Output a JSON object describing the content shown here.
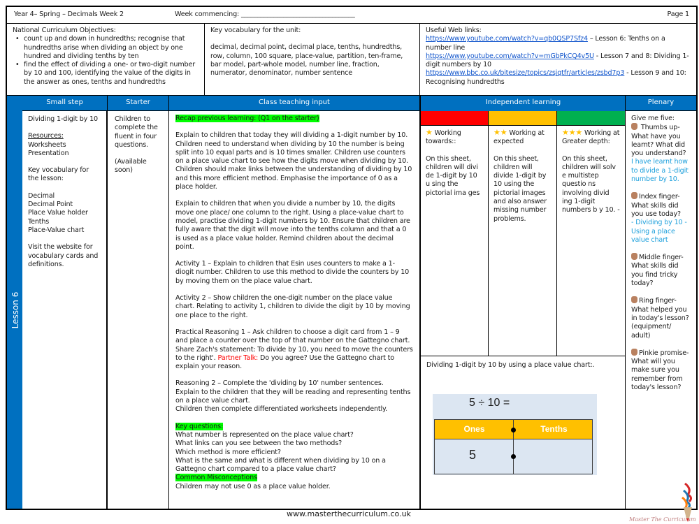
{
  "header": {
    "title": "Year 4– Spring – Decimals  Week 2",
    "week_commencing": "Week commencing: ___________________________________",
    "page": "Page 1"
  },
  "objectives": {
    "heading": "National Curriculum Objectives:",
    "items": [
      "count up and down in hundredths; recognise that hundredths arise when dividing an object by one hundred and dividing tenths by ten",
      "find the effect of dividing a one- or two-digit number by 10 and 100, identifying the value of the digits in the answer as ones, tenths and hundredths"
    ]
  },
  "vocabulary": {
    "heading": "Key vocabulary for the unit:",
    "text": "decimal, decimal point, decimal place, tenths, hundredths, row, column, 100 square, place-value, partition, ten-frame, bar model, part-whole model, number line, fraction, numerator, denominator, number sentence"
  },
  "web_links": {
    "heading": "Useful Web links:",
    "links": [
      {
        "url": "https://www.youtube.com/watch?v=qb0QSP7Sfz4",
        "desc": " – Lesson 6: Tenths on a number line"
      },
      {
        "url": "https://www.youtube.com/watch?v=mGbPkCQ4v5U",
        "desc": " - Lesson 7 and 8: Dividing 1-digit  numbers by 10"
      },
      {
        "url": "https://www.bbc.co.uk/bitesize/topics/zsjqtfr/articles/zsbd7p3",
        "desc": " -  Lesson 9 and 10: Recognising hundredths"
      }
    ]
  },
  "columns": {
    "small_step": "Small step",
    "starter": "Starter",
    "class_teaching": "Class teaching input",
    "independent": "Independent learning",
    "plenary": "Plenary"
  },
  "lesson_label": "Lesson 6",
  "small_step": {
    "title": "Dividing 1-digit by 10",
    "resources_heading": "Resources:",
    "resources": [
      "Worksheets",
      "Presentation"
    ],
    "vocab_heading": "Key vocabulary for the lesson:",
    "vocab": [
      "Decimal",
      "Decimal Point",
      "Place Value holder",
      "Tenths",
      "Place-Value chart"
    ],
    "visit": "Visit the website for vocabulary cards and definitions."
  },
  "starter": {
    "text": "Children to complete the fluent in four questions.",
    "note": "(Available soon)"
  },
  "teaching": {
    "recap": "Recap previous learning: (Q1 on the starter)",
    "para1": "Explain to children that today they will dividing a 1-digit number by 10. Children need to understand when dividing by 10 the number is being split into 10 equal parts and is 10 times smaller. Children use counters on a place value chart to see how the digits move when dividing by 10. Children should make links between the understanding of dividing by 10 and this more efficient method. Emphasise the importance of 0 as a place holder.",
    "para2": "Explain to children that when you divide a number by 10, the digits move one place/ one column to the right. Using a place-value chart to model, practise dividing 1-digit numbers by 10. Ensure that children are fully aware that the digit will move into the tenths column and that a 0 is used as a place value holder. Remind children about the decimal point.",
    "activity1": "Activity 1 – Explain to children that Esin uses counters to make a 1-diogit number. Children to use this method to divide the counters by 10 by moving them on the place value chart.",
    "activity2": "Activity 2 – Show children the one-digit number on the place value chart. Relating to activity 1, children to divide the digit by 10 by moving one place to the right.",
    "reasoning1_a": "Practical Reasoning 1 – Ask children to choose a digit card from 1 – 9 and place a counter over the top of that number on the Gattegno chart. Share Zach's statement: To divide by 10, you need to move the counters to the right'. ",
    "partner_talk": "Partner Talk:",
    "reasoning1_b": " Do you agree? Use the Gattegno chart to explain your reason.",
    "reasoning2": "Reasoning 2 – Complete the 'dividing by 10'  number sentences.",
    "reasoning2_b": "Explain to the children that they will be reading and representing tenths on a place value chart.",
    "reasoning2_c": "Children then complete differentiated worksheets independently.",
    "key_questions_heading": "Key questions:",
    "key_questions": [
      "What number is represented on the place value chart?",
      "What links can you see between the two methods?",
      "Which method is more efficient?",
      "What is the same and what is different when dividing by 10 on a Gattegno chart compared to a place value chart?"
    ],
    "misconceptions_heading": "Common Misconceptions",
    "misconceptions": "Children may not use 0 as a place value holder."
  },
  "independent": {
    "colors": [
      "#ff0000",
      "#ffc000",
      "#00b050"
    ],
    "levels": [
      {
        "stars": "★",
        "label": " Working towards::",
        "text": "On this sheet, children will divi de 1-digit by 10 u sing the pictorial ima ges"
      },
      {
        "stars": "★★",
        "label": " Working at expected",
        "text": "On this sheet, children will divide 1-digit by 10 using the pictorial images and also answer missing number problems."
      },
      {
        "stars": "★★★",
        "label": " Working at Greater depth:",
        "text": "On this sheet, children will solv e multistep questio ns involving divid ing 1-digit numbers b y 10. -"
      }
    ],
    "example_caption": "Dividing 1-digit by 10 by using a place value chart:.",
    "example": {
      "equation": "5 ÷ 10 =",
      "col_ones": "Ones",
      "col_tenths": "Tenths",
      "ones_value": "5",
      "tenths_value": ""
    }
  },
  "plenary": {
    "intro": "Give me five:",
    "items": [
      {
        "label": " Thumbs up- What have you learnt? What did you understand?",
        "answer": "I have learnt how to divide a 1-digit number by 10."
      },
      {
        "label": "Index finger- What skills did you use today?",
        "answer": "- Dividing by 10 -Using a place value chart"
      },
      {
        "label": "Middle finger- What skills did you find tricky today?",
        "answer": ""
      },
      {
        "label": "Ring finger- What helped you in today's lesson? (equipment/ adult)",
        "answer": ""
      },
      {
        "label": "Pinkie promise- What will you make sure you remember from today's lesson?",
        "answer": ""
      }
    ]
  },
  "footer": {
    "website": "www.masterthecurriculum.co.uk",
    "brand": "Master The Curriculum"
  }
}
